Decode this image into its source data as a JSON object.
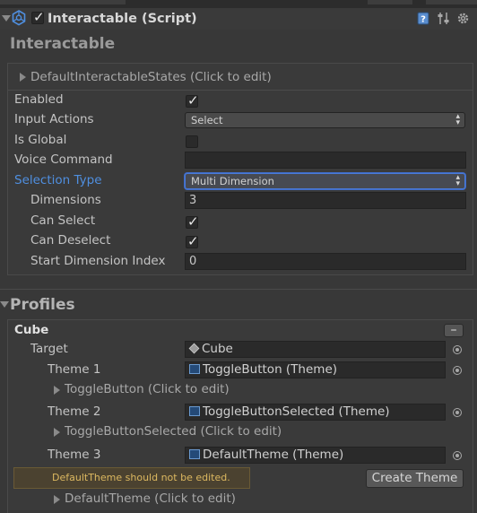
{
  "header": {
    "title": "Interactable (Script)",
    "enabled": true,
    "icons": [
      "script-icon",
      "help-book-icon",
      "preset-sliders-icon",
      "settings-gear-icon"
    ]
  },
  "section_title": "Interactable",
  "states_foldout": "DefaultInteractableStates (Click to edit)",
  "properties": {
    "enabled_label": "Enabled",
    "enabled_value": true,
    "input_actions_label": "Input Actions",
    "input_actions_value": "Select",
    "is_global_label": "Is Global",
    "is_global_value": false,
    "voice_command_label": "Voice Command",
    "voice_command_value": "",
    "selection_type_label": "Selection Type",
    "selection_type_value": "Multi Dimension",
    "dimensions_label": "Dimensions",
    "dimensions_value": "3",
    "can_select_label": "Can Select",
    "can_select_value": true,
    "can_deselect_label": "Can Deselect",
    "can_deselect_value": true,
    "start_dimension_label": "Start Dimension Index",
    "start_dimension_value": "0"
  },
  "profiles": {
    "title": "Profiles",
    "profile_name": "Cube",
    "remove_label": "–",
    "target_label": "Target",
    "target_value": "Cube",
    "themes": [
      {
        "label": "Theme 1",
        "value": "ToggleButton (Theme)",
        "foldout": "ToggleButton (Click to edit)"
      },
      {
        "label": "Theme 2",
        "value": "ToggleButtonSelected (Theme)",
        "foldout": "ToggleButtonSelected (Click to edit)"
      },
      {
        "label": "Theme 3",
        "value": "DefaultTheme (Theme)",
        "foldout": "DefaultTheme (Click to edit)"
      }
    ],
    "warning": "DefaultTheme should not be edited.",
    "create_theme_label": "Create Theme"
  },
  "colors": {
    "background": "#383838",
    "accent_blue": "#4f8fe0",
    "warning_text": "#dcb860"
  }
}
